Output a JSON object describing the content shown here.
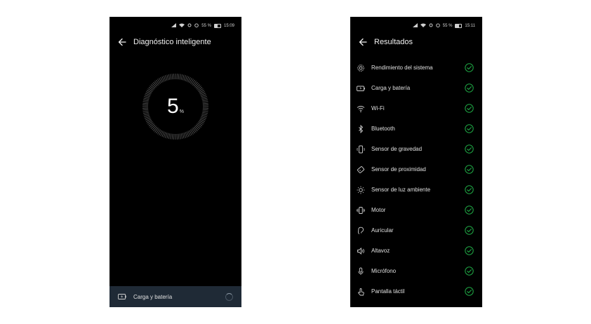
{
  "left_screen": {
    "status": {
      "battery_percent": "55 %",
      "time": "15:09"
    },
    "title": "Diagnóstico inteligente",
    "progress": {
      "value": "5",
      "unit": "%"
    },
    "current_test": "Carga y batería"
  },
  "right_screen": {
    "status": {
      "battery_percent": "55 %",
      "time": "15:11"
    },
    "title": "Resultados",
    "results": [
      {
        "label": "Rendimiento del sistema",
        "icon": "gear-icon",
        "status": "passed"
      },
      {
        "label": "Carga y batería",
        "icon": "battery-icon",
        "status": "passed"
      },
      {
        "label": "Wi-Fi",
        "icon": "wifi-icon",
        "status": "passed"
      },
      {
        "label": "Bluetooth",
        "icon": "bluetooth-icon",
        "status": "passed"
      },
      {
        "label": "Sensor de gravedad",
        "icon": "gravity-sensor-icon",
        "status": "passed"
      },
      {
        "label": "Sensor de proximidad",
        "icon": "proximity-sensor-icon",
        "status": "passed"
      },
      {
        "label": "Sensor de luz ambiente",
        "icon": "sun-icon",
        "status": "passed"
      },
      {
        "label": "Motor",
        "icon": "vibration-icon",
        "status": "passed"
      },
      {
        "label": "Auricular",
        "icon": "earpiece-icon",
        "status": "passed"
      },
      {
        "label": "Altavoz",
        "icon": "speaker-icon",
        "status": "passed"
      },
      {
        "label": "Micrófono",
        "icon": "microphone-icon",
        "status": "passed"
      },
      {
        "label": "Pantalla táctil",
        "icon": "touch-icon",
        "status": "passed"
      }
    ]
  },
  "colors": {
    "check_green": "#1fa845",
    "bottom_bar": "#1f2a36",
    "background": "#000000"
  }
}
